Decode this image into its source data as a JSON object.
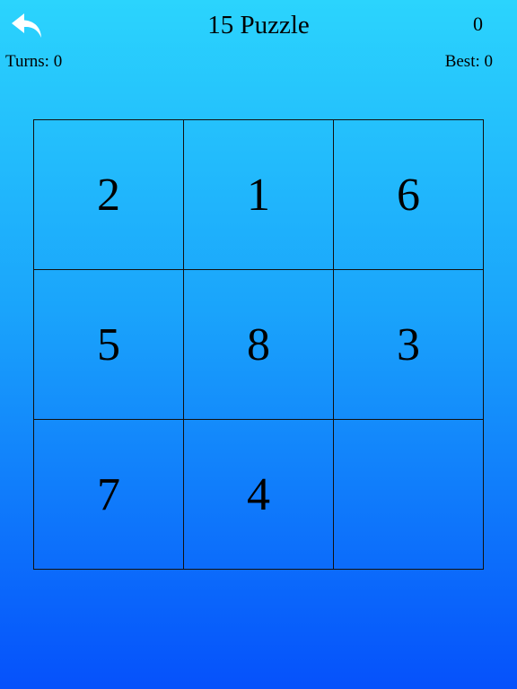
{
  "header": {
    "back_icon": "undo-arrow-icon",
    "title": "15 Puzzle",
    "timer": "0"
  },
  "stats": {
    "turns_label": "Turns: ",
    "turns_value": "0",
    "best_label": "Best: ",
    "best_value": "0"
  },
  "board": {
    "size": 3,
    "tiles": [
      "2",
      "1",
      "6",
      "5",
      "8",
      "3",
      "7",
      "4",
      ""
    ]
  },
  "colors": {
    "background_top": "#2bd4fd",
    "background_bottom": "#0551fb",
    "grid_line": "#111111",
    "text": "#000000",
    "icon": "#ffffff"
  }
}
